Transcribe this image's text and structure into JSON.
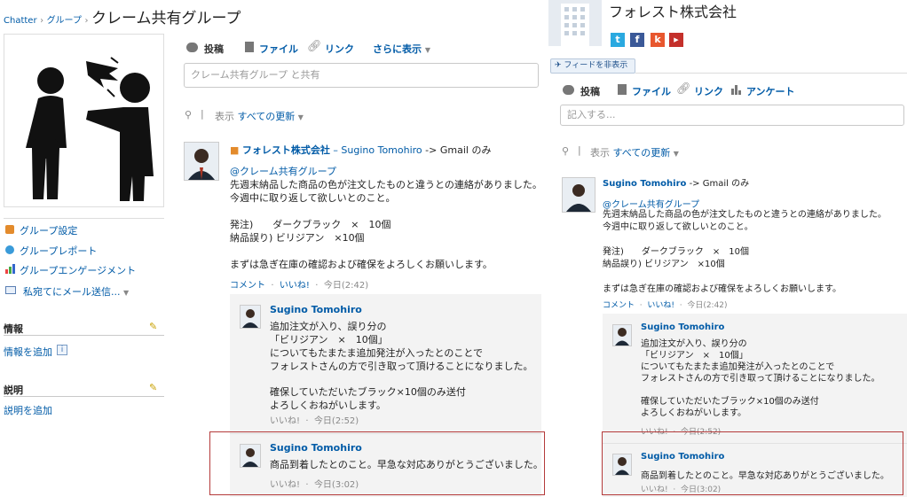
{
  "breadcrumb": {
    "chatter": "Chatter",
    "sep1": "›",
    "groups": "グループ",
    "sep2": "›",
    "title": "クレーム共有グループ"
  },
  "left_panel": {
    "links": [
      "グループ設定",
      "グループレポート",
      "グループエンゲージメント",
      "私宛てにメール送信..."
    ],
    "info": {
      "title": "情報",
      "add": "情報を追加"
    },
    "desc": {
      "title": "説明",
      "add": "説明を追加"
    }
  },
  "feed_left": {
    "toolbar": {
      "post": "投稿",
      "file": "ファイル",
      "link": "リンク",
      "more": "さらに表示"
    },
    "input_placeholder": "クレーム共有グループ と共有",
    "filter": {
      "prefix": "表示",
      "value": "すべての更新"
    },
    "post": {
      "org": "フォレスト株式会社",
      "dash": "–",
      "author": "Sugino Tomohiro",
      "arrow": "-> Gmail のみ",
      "mention": "@クレーム共有グループ",
      "lines": [
        "先週末納品した商品の色が注文したものと違うとの連絡がありました。",
        "今週中に取り返して欲しいとのこと。",
        "",
        "発注)　　ダークブラック　×　10個",
        "納品誤り) ビリジアン　×10個",
        "",
        "まずは急ぎ在庫の確認および確保をよろしくお願いします。"
      ],
      "actions": {
        "comment": "コメント",
        "like": "いいね!",
        "time": "今日(2:42)"
      }
    },
    "comments": [
      {
        "author": "Sugino Tomohiro",
        "lines": [
          "追加注文が入り、誤り分の",
          "「ビリジアン　×　10個」",
          "についてもたまたま追加発注が入ったとのことで",
          "フォレストさんの方で引き取って頂けることになりました。",
          "",
          "確保していただいたブラック×10個のみ送付",
          "よろしくおねがいします。"
        ],
        "like": "いいね!",
        "time": "今日(2:52)"
      },
      {
        "author": "Sugino Tomohiro",
        "lines": [
          "商品到着したとのこと。早急な対応ありがとうございました。"
        ],
        "like": "いいね!",
        "time": "今日(3:02)"
      }
    ]
  },
  "right_panel": {
    "company": "フォレスト株式会社",
    "hide_feed": "フィードを非表示",
    "toolbar": {
      "post": "投稿",
      "file": "ファイル",
      "link": "リンク",
      "survey": "アンケート"
    },
    "input_placeholder": "記入する...",
    "filter": {
      "prefix": "表示",
      "value": "すべての更新"
    },
    "post": {
      "author": "Sugino Tomohiro",
      "arrow": "-> Gmail のみ",
      "mention": "@クレーム共有グループ",
      "lines": [
        "先週末納品した商品の色が注文したものと違うとの連絡がありました。",
        "今週中に取り返して欲しいとのこと。",
        "",
        "発注)　　ダークブラック　×　10個",
        "納品誤り) ビリジアン　×10個",
        "",
        "まずは急ぎ在庫の確認および確保をよろしくお願いします。"
      ],
      "actions": {
        "comment": "コメント",
        "like": "いいね!",
        "time": "今日(2:42)"
      }
    },
    "comments": [
      {
        "author": "Sugino Tomohiro",
        "lines": [
          "追加注文が入り、誤り分の",
          "「ビリジアン　×　10個」",
          "についてもたまたま追加発注が入ったとのことで",
          "フォレストさんの方で引き取って頂けることになりました。",
          "",
          "確保していただいたブラック×10個のみ送付",
          "よろしくおねがいします。"
        ],
        "like": "いいね!",
        "time": "今日(2:52)"
      },
      {
        "author": "Sugino Tomohiro",
        "lines": [
          "商品到着したとのこと。早急な対応ありがとうございました。"
        ],
        "like": "いいね!",
        "time": "今日(3:02)"
      }
    ]
  },
  "social_icons": [
    "twitter-icon",
    "facebook-icon",
    "klout-icon",
    "youtube-icon"
  ],
  "colors": {
    "link": "#015ba7",
    "highlight": "#b43a3a",
    "comment_bg": "#f3f3f3"
  }
}
